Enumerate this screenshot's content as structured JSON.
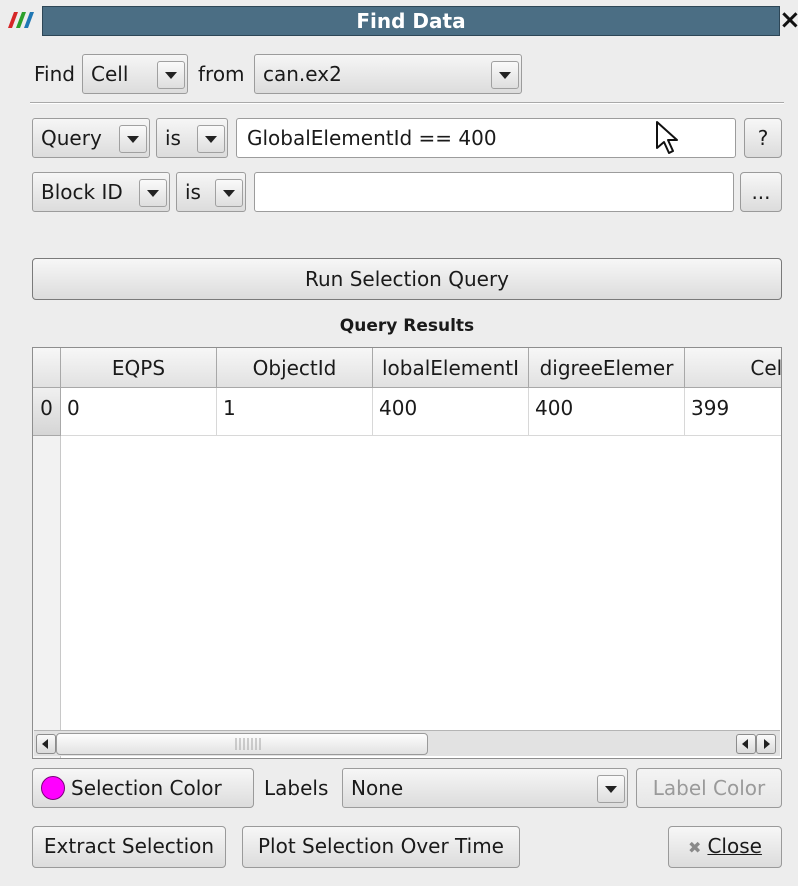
{
  "window": {
    "title": "Find Data",
    "close_glyph": "×"
  },
  "find_row": {
    "find_label": "Find",
    "find_type": "Cell",
    "from_label": "from",
    "source": "can.ex2"
  },
  "query1": {
    "field": "Query",
    "operator": "is",
    "value": "GlobalElementId == 400",
    "help_button": "?"
  },
  "query2": {
    "field": "Block ID",
    "operator": "is",
    "value": "",
    "more_button": "..."
  },
  "run_button": "Run Selection Query",
  "results": {
    "title": "Query Results",
    "columns": [
      "EQPS",
      "ObjectId",
      "lobalElementI",
      "digreeElemer",
      "Cell I"
    ],
    "rows": [
      {
        "index": "0",
        "cells": [
          "0",
          "1",
          "400",
          "400",
          "399"
        ]
      }
    ]
  },
  "bottom": {
    "selection_color_button": "Selection Color",
    "selection_color": "#ff00ff",
    "labels_label": "Labels",
    "labels_value": "None",
    "label_color_button": "Label Color",
    "extract_button": "Extract Selection",
    "plot_button": "Plot Selection Over Time",
    "close_button": "Close",
    "close_icon_glyph": "✖"
  },
  "colors": {
    "title_bar": "#4b6e84",
    "background": "#ededed"
  },
  "icons": {
    "app_logo": "paraview-logo-icon",
    "cursor": "mouse-pointer-icon"
  }
}
